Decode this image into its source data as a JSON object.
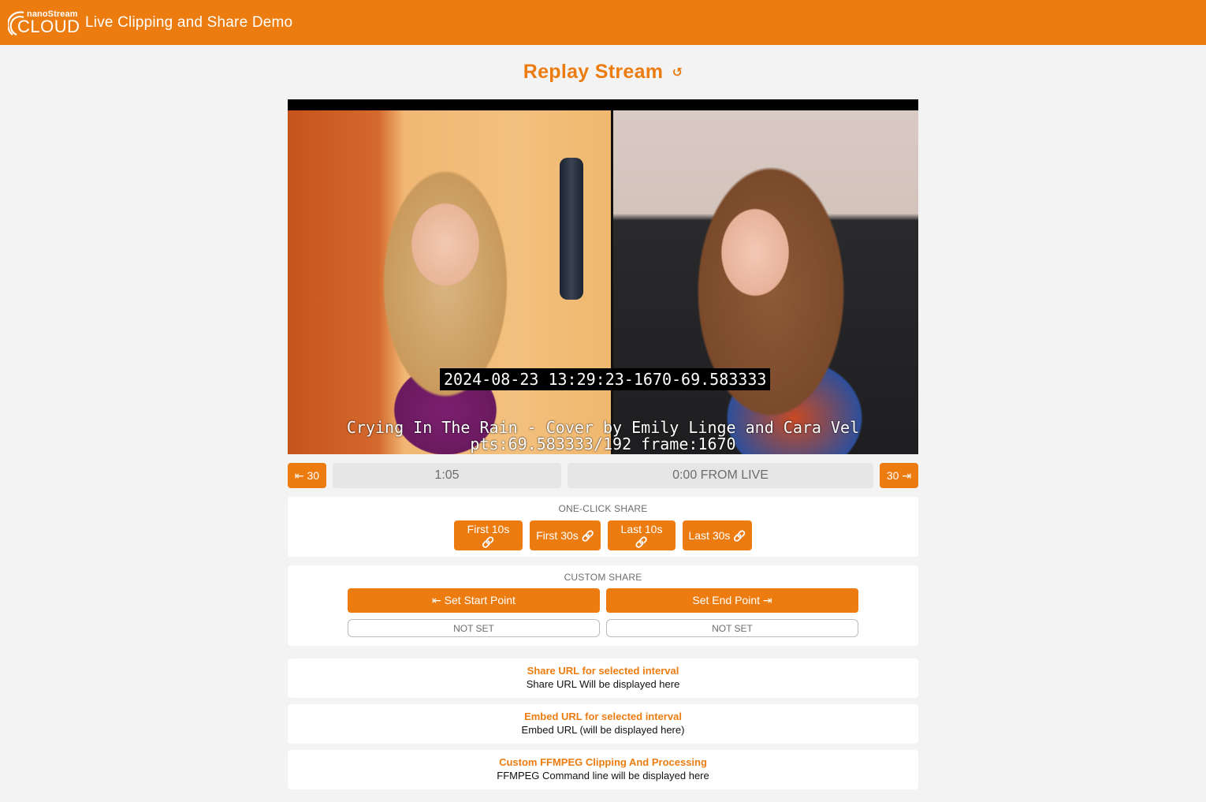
{
  "header": {
    "logo_small": "nanoStream",
    "logo_big": "CLOUD",
    "title": "Live Clipping and Share Demo",
    "brand_color": "#ec7c10"
  },
  "replay": {
    "title": "Replay Stream",
    "reload_icon": "↺"
  },
  "video": {
    "timestamp_overlay": "2024-08-23 13:29:23-1670-69.583333",
    "caption_line1": "Crying In The Rain - Cover by Emily Linge and Cara Vel",
    "caption_line2": "pts:69.583333/192 frame:1670"
  },
  "controls": {
    "back_label": "⇤ 30",
    "position": "1:05",
    "live_offset": "0:00 FROM LIVE",
    "forward_label": "30 ⇥"
  },
  "one_click": {
    "label": "ONE-CLICK SHARE",
    "link_icon": "🔗",
    "buttons": [
      {
        "label": "First 10s"
      },
      {
        "label": "First 30s"
      },
      {
        "label": "Last 10s"
      },
      {
        "label": "Last 30s"
      }
    ]
  },
  "custom_share": {
    "label": "CUSTOM SHARE",
    "start_button": "⇤ Set Start Point",
    "end_button": "Set End Point ⇥",
    "start_value": "NOT SET",
    "end_value": "NOT SET"
  },
  "share_url": {
    "title": "Share URL for selected interval",
    "text": "Share URL Will be displayed here"
  },
  "embed_url": {
    "title": "Embed URL for selected interval",
    "text": "Embed URL (will be displayed here)"
  },
  "ffmpeg": {
    "title": "Custom FFMPEG Clipping And Processing",
    "text": "FFMPEG Command line will be displayed here"
  }
}
